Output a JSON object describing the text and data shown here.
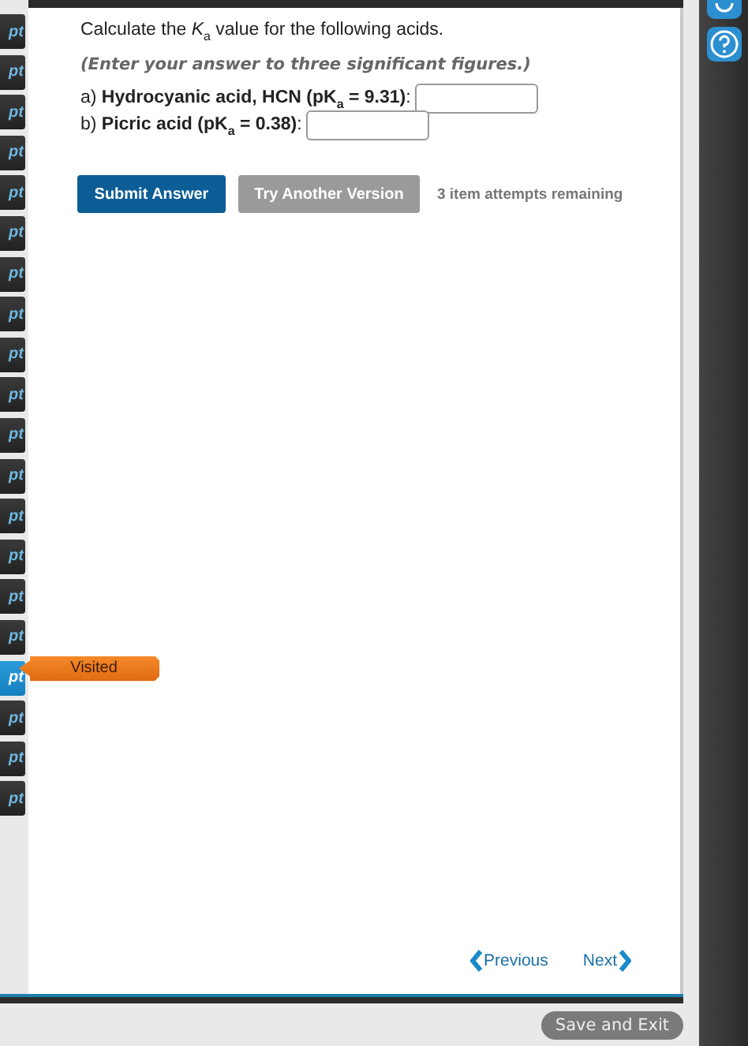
{
  "rail": {
    "tabs": [
      {
        "label": "pt",
        "selected": false
      },
      {
        "label": "pt",
        "selected": false
      },
      {
        "label": "pt",
        "selected": false
      },
      {
        "label": "pt",
        "selected": false
      },
      {
        "label": "pt",
        "selected": false
      },
      {
        "label": "pt",
        "selected": false
      },
      {
        "label": "pt",
        "selected": false
      },
      {
        "label": "pt",
        "selected": false
      },
      {
        "label": "pt",
        "selected": false
      },
      {
        "label": "pt",
        "selected": false
      },
      {
        "label": "pt",
        "selected": false
      },
      {
        "label": "pt",
        "selected": false
      },
      {
        "label": "pt",
        "selected": false
      },
      {
        "label": "pt",
        "selected": false
      },
      {
        "label": "pt",
        "selected": false
      },
      {
        "label": "pt",
        "selected": false
      },
      {
        "label": "pt",
        "selected": true
      },
      {
        "label": "pt",
        "selected": false
      },
      {
        "label": "pt",
        "selected": false
      },
      {
        "label": "pt",
        "selected": false
      }
    ],
    "tooltip": "Visited"
  },
  "question": {
    "prompt": "Calculate the *K*$_{a}$ value for the following acids.",
    "instruction": "(Enter your answer to three significant figures.)",
    "parts": [
      {
        "label": "a) **Hydrocyanic acid, HCN (pK$_{a}$ = 9.31)**:"
      },
      {
        "label": "b) **Picric acid (pK$_{a}$ = 0.38)**:"
      }
    ],
    "buttons": [
      {
        "label": "Submit Answer",
        "kind": "primary"
      },
      {
        "label": "Try Another Version",
        "kind": "secondary"
      }
    ],
    "attempts": "3 item attempts remaining"
  },
  "nav": {
    "previous": "Previous",
    "next": "Next"
  },
  "footer": {
    "save_button": "Save and Exit"
  }
}
